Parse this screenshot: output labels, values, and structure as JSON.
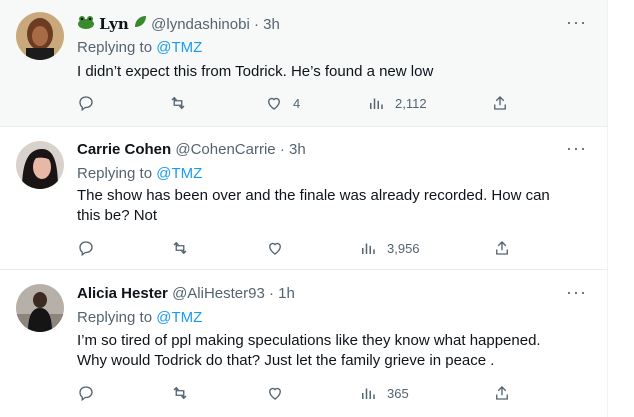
{
  "tweets": [
    {
      "display_name": "",
      "handle": "@lyndashinobi",
      "separator": "·",
      "time": "3h",
      "replying_prefix": "Replying to",
      "replying_to": "@TMZ",
      "text": "I didn’t expect this from Todrick. He’s found a new low",
      "likes": "4",
      "views": "2,112",
      "display_name_icons": [
        "frog-icon",
        "leaf-icon"
      ],
      "display_name_script": "Lyn"
    },
    {
      "display_name": "Carrie Cohen",
      "handle": "@CohenCarrie",
      "separator": "·",
      "time": "3h",
      "replying_prefix": "Replying to",
      "replying_to": "@TMZ",
      "text_line1": "The show has been over and the finale was already recorded. How can",
      "text_line2": "this be? Not",
      "views": "3,956"
    },
    {
      "display_name": "Alicia Hester",
      "handle": "@AliHester93",
      "separator": "·",
      "time": "1h",
      "replying_prefix": "Replying to",
      "replying_to": "@TMZ",
      "text_line1": "I’m so tired of ppl making speculations like they know what happened.",
      "text_line2": "Why would Todrick do that? Just let the family grieve in peace .",
      "views": "365"
    }
  ],
  "colors": {
    "accent": "#1d9bf0",
    "muted": "#536471",
    "text": "#0f1419",
    "name_green": "#3a8a2e"
  },
  "more_label": "···"
}
